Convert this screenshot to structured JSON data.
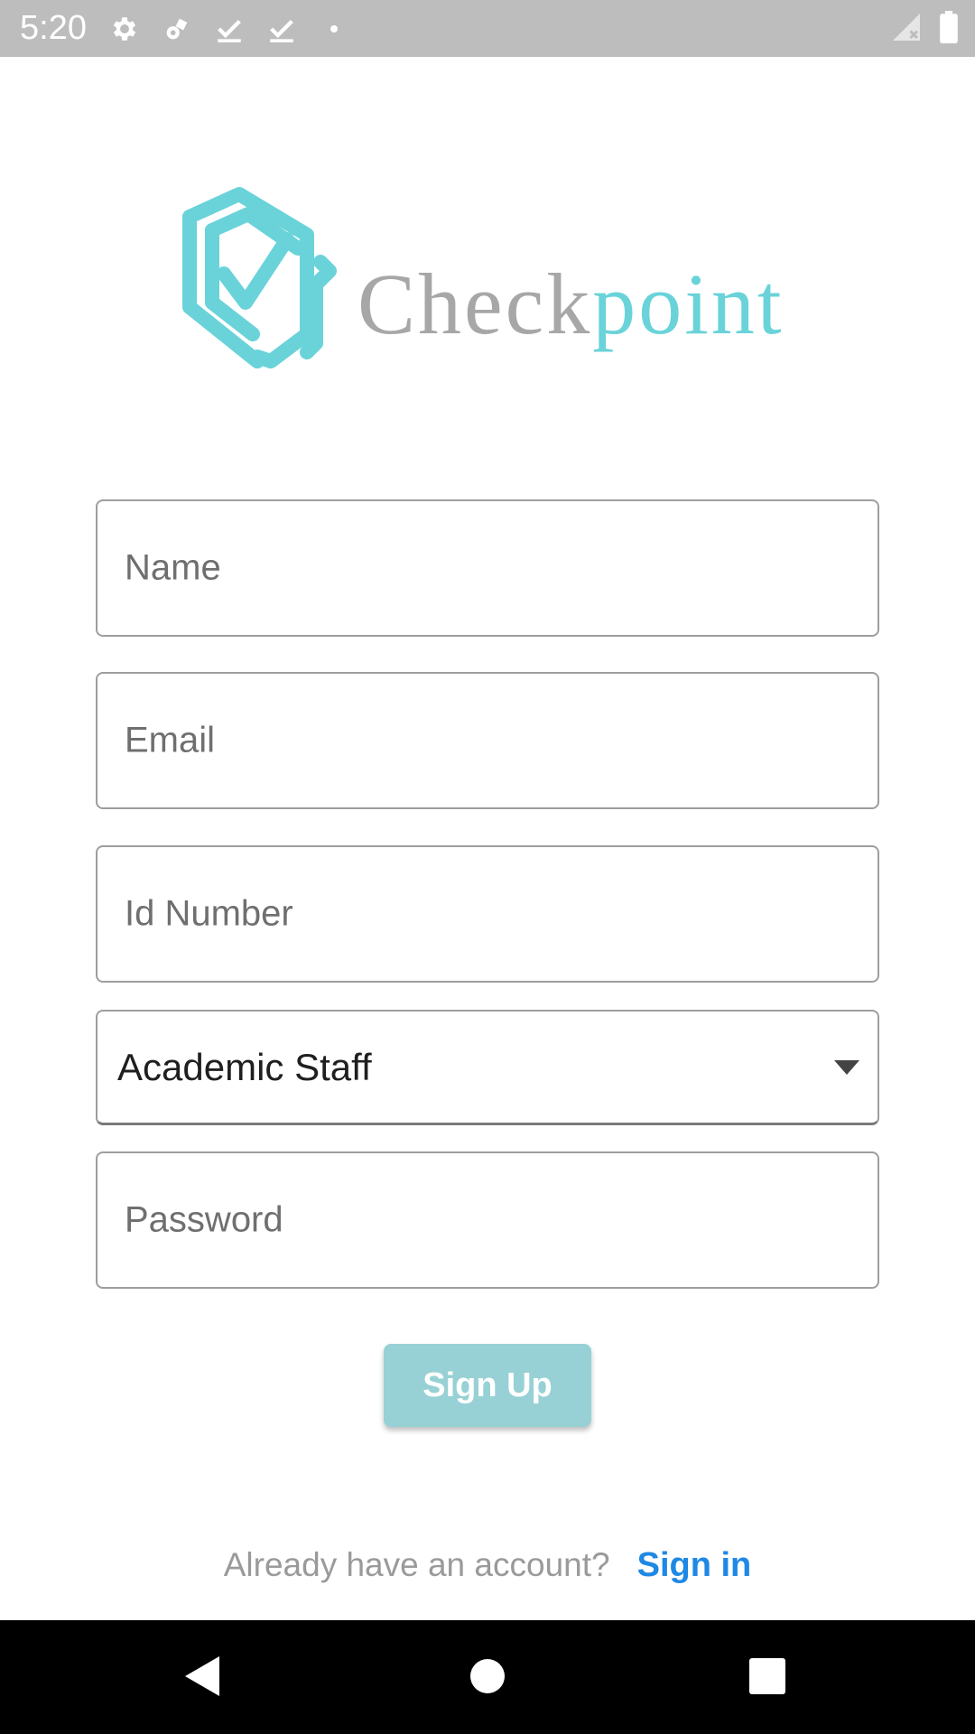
{
  "status_bar": {
    "time": "5:20",
    "left_icons": [
      "gear-icon",
      "gear-bug-icon",
      "download-done-icon",
      "download-done-icon",
      "dot-icon"
    ],
    "right_icons": [
      "signal-off-icon",
      "battery-icon"
    ]
  },
  "logo": {
    "text_part1": "Check",
    "text_part2": "point",
    "primary_color": "#69d3d9",
    "secondary_color": "#a7a7a7"
  },
  "form": {
    "name_placeholder": "Name",
    "email_placeholder": "Email",
    "id_placeholder": "Id Number",
    "role_value": "Academic Staff",
    "password_placeholder": "Password"
  },
  "actions": {
    "signup_label": "Sign Up",
    "signup_color": "#97d1d5"
  },
  "signin": {
    "prompt": "Already have an account?",
    "link": "Sign in",
    "link_color": "#1e88e5"
  },
  "nav_bar": {
    "icons": [
      "back-icon",
      "home-icon",
      "recents-icon"
    ]
  }
}
